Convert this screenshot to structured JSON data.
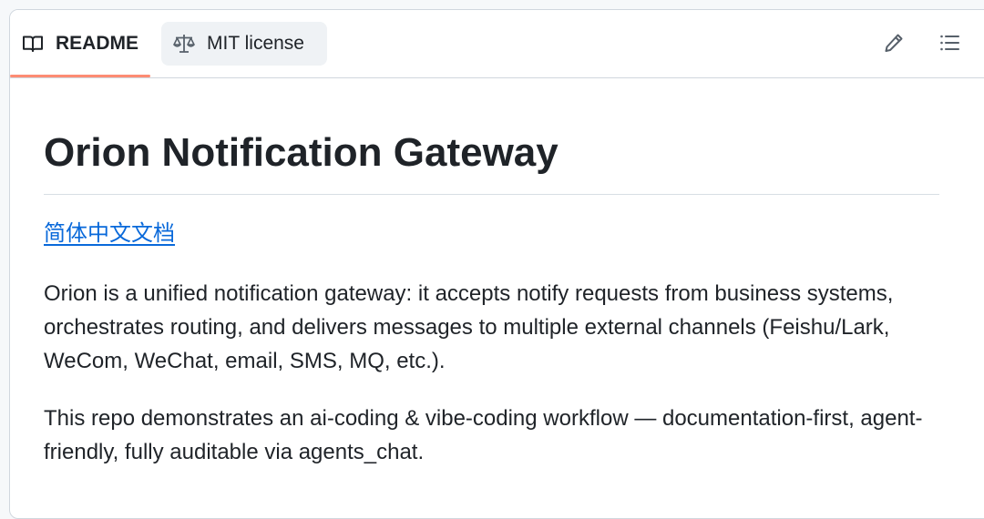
{
  "tabs": {
    "readme_label": "README",
    "license_label": "MIT license"
  },
  "toolbar": {
    "edit_icon": "pencil-icon",
    "outline_icon": "list-unordered-icon"
  },
  "readme": {
    "title": "Orion Notification Gateway",
    "lang_link": "简体中文文档",
    "paragraphs": [
      "Orion is a unified notification gateway: it accepts notify requests from business systems, orchestrates routing, and delivers messages to multiple external channels (Feishu/Lark, WeCom, WeChat, email, SMS, MQ, etc.).",
      "This repo demonstrates an ai-coding & vibe-coding workflow — documentation-first, agent-friendly, fully auditable via agents_chat."
    ]
  },
  "colors": {
    "active_tab_underline": "#fd8c73",
    "link": "#0969da",
    "text": "#1f2328",
    "border": "#d0d7de"
  }
}
